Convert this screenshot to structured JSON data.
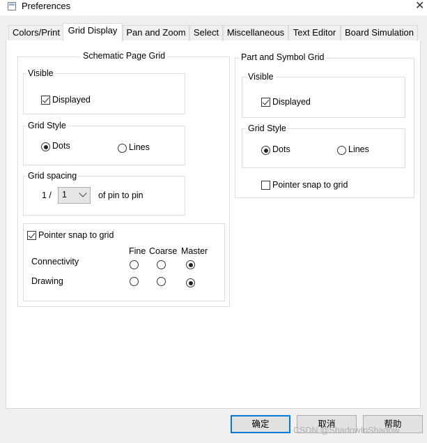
{
  "window": {
    "title": "Preferences",
    "close_glyph": "✕"
  },
  "tabs": [
    {
      "label": "Colors/Print"
    },
    {
      "label": "Grid Display"
    },
    {
      "label": "Pan and Zoom"
    },
    {
      "label": "Select"
    },
    {
      "label": "Miscellaneous"
    },
    {
      "label": "Text Editor"
    },
    {
      "label": "Board Simulation"
    }
  ],
  "selected_tab": "Grid Display",
  "schematic": {
    "title": "Schematic Page Grid",
    "visible": {
      "title": "Visible",
      "displayed_label": "Displayed",
      "displayed_checked": true
    },
    "grid_style": {
      "title": "Grid Style",
      "dots_label": "Dots",
      "lines_label": "Lines",
      "selected": "Dots"
    },
    "grid_spacing": {
      "title": "Grid spacing",
      "prefix": "1 /",
      "value": "1",
      "suffix": "of pin to pin"
    },
    "snap": {
      "label": "Pointer snap to grid",
      "checked": true,
      "columns": [
        "Fine",
        "Coarse",
        "Master"
      ],
      "rows": [
        {
          "label": "Connectivity",
          "selected": "Master"
        },
        {
          "label": "Drawing",
          "selected": "Master"
        }
      ]
    }
  },
  "part": {
    "title": "Part and Symbol Grid",
    "visible": {
      "title": "Visible",
      "displayed_label": "Displayed",
      "displayed_checked": true
    },
    "grid_style": {
      "title": "Grid Style",
      "dots_label": "Dots",
      "lines_label": "Lines",
      "selected": "Dots"
    },
    "snap": {
      "label": "Pointer snap to grid",
      "checked": false
    }
  },
  "buttons": {
    "ok": "确定",
    "cancel": "取消",
    "help": "帮助"
  },
  "watermark": "CSDN @ShadowInShadow"
}
